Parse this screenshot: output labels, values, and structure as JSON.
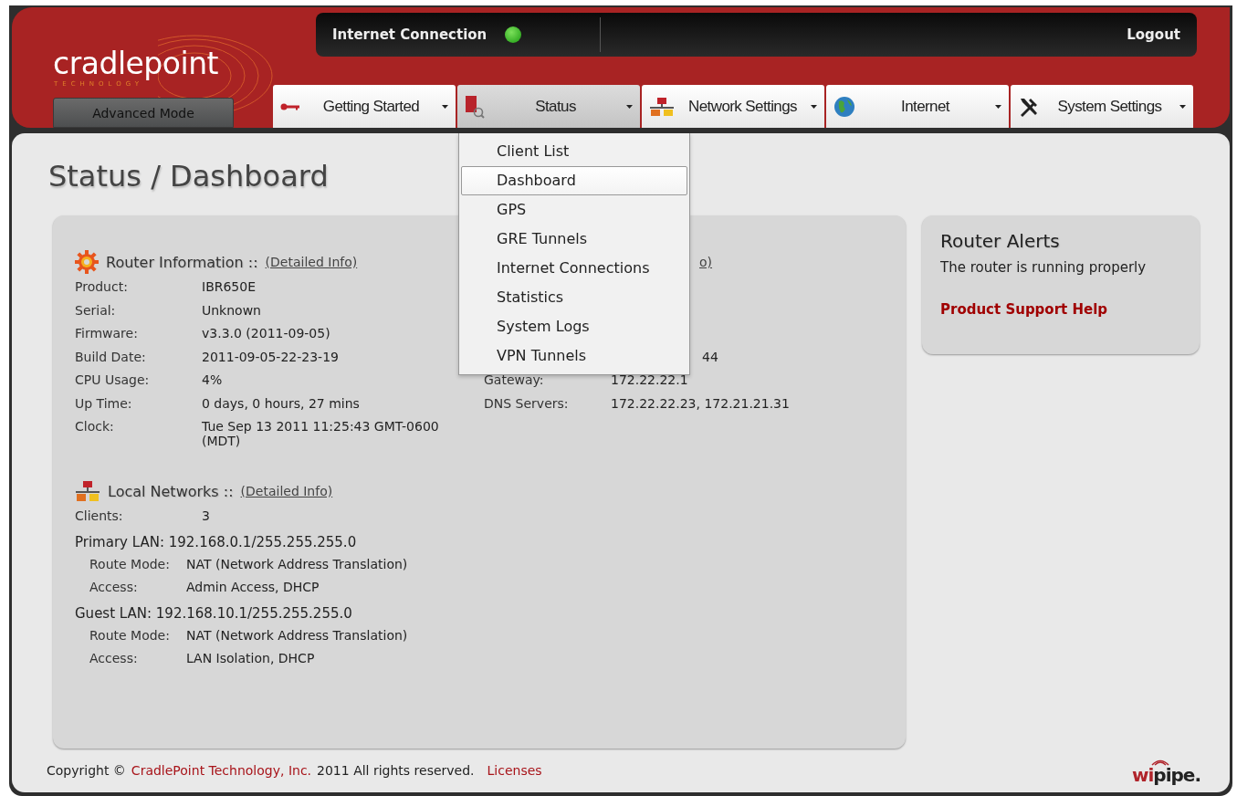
{
  "logo": {
    "name": "cradlepoint",
    "tagline": "TECHNOLOGY"
  },
  "mode_button": "Advanced Mode",
  "top_bar": {
    "connection_label": "Internet Connection",
    "connected": true,
    "logout": "Logout"
  },
  "tabs": [
    {
      "label": "Getting Started",
      "selected": false
    },
    {
      "label": "Status",
      "selected": true
    },
    {
      "label": "Network Settings",
      "selected": false
    },
    {
      "label": "Internet",
      "selected": false
    },
    {
      "label": "System Settings",
      "selected": false
    }
  ],
  "menu": [
    {
      "label": "Client List",
      "selected": false
    },
    {
      "label": "Dashboard",
      "selected": true
    },
    {
      "label": "GPS",
      "selected": false
    },
    {
      "label": "GRE Tunnels",
      "selected": false
    },
    {
      "label": "Internet Connections",
      "selected": false
    },
    {
      "label": "Statistics",
      "selected": false
    },
    {
      "label": "System Logs",
      "selected": false
    },
    {
      "label": "VPN Tunnels",
      "selected": false
    }
  ],
  "page_title": "Status / Dashboard",
  "router_info": {
    "title": "Router Information ::",
    "link": "(Detailed Info)",
    "rows": [
      {
        "label": "Product:",
        "value": "IBR650E"
      },
      {
        "label": "Serial:",
        "value": "Unknown"
      },
      {
        "label": "Firmware:",
        "value": "v3.3.0 (2011-09-05)"
      },
      {
        "label": "Build Date:",
        "value": "2011-09-05-22-23-19"
      },
      {
        "label": "CPU Usage:",
        "value": "4%"
      },
      {
        "label": "Up Time:",
        "value": "0 days, 0 hours, 27 mins"
      },
      {
        "label": "Clock:",
        "value": "Tue Sep 13 2011 11:25:43 GMT-0600 (MDT)"
      }
    ]
  },
  "internet_info": {
    "link_fragment": "o)",
    "value_fragment": "44",
    "rows": [
      {
        "label": "Gateway:",
        "value": "172.22.22.1"
      },
      {
        "label": "DNS Servers:",
        "value": "172.22.22.23, 172.21.21.31"
      }
    ]
  },
  "local_networks": {
    "title": "Local Networks ::",
    "link": "(Detailed Info)",
    "clients_label": "Clients:",
    "clients_value": "3",
    "lans": [
      {
        "heading": "Primary LAN: 192.168.0.1/255.255.255.0",
        "rows": [
          {
            "label": "Route Mode:",
            "value": "NAT (Network Address Translation)"
          },
          {
            "label": "Access:",
            "value": "Admin Access, DHCP"
          }
        ]
      },
      {
        "heading": "Guest LAN: 192.168.10.1/255.255.255.0",
        "rows": [
          {
            "label": "Route Mode:",
            "value": "NAT (Network Address Translation)"
          },
          {
            "label": "Access:",
            "value": "LAN Isolation, DHCP"
          }
        ]
      }
    ]
  },
  "alerts": {
    "title": "Router Alerts",
    "message": "The router is running properly",
    "link": "Product Support Help"
  },
  "footer": {
    "copyright": "Copyright ©",
    "company": "CradlePoint Technology, Inc.",
    "rights": "2011 All rights reserved.",
    "licenses": "Licenses",
    "brand_red": "wi",
    "brand_dark": "pipe."
  }
}
